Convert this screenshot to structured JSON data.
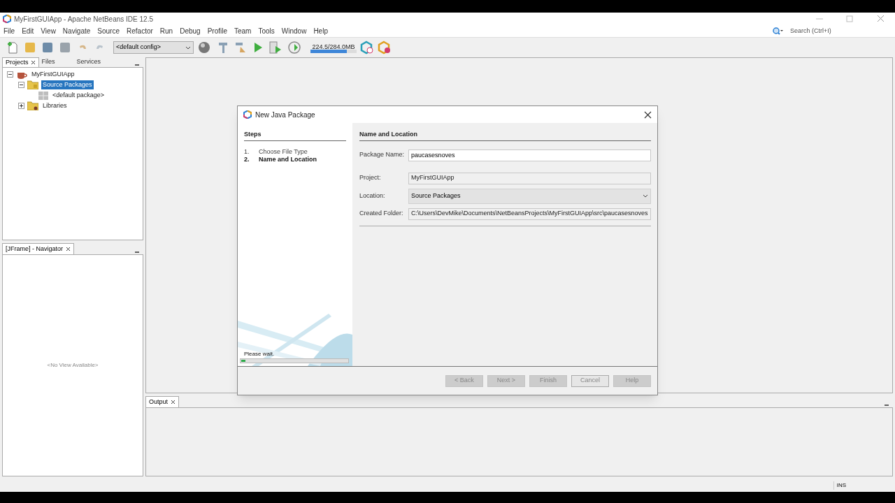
{
  "window": {
    "title": "MyFirstGUIApp - Apache NetBeans IDE 12.5"
  },
  "menu": [
    "File",
    "Edit",
    "View",
    "Navigate",
    "Source",
    "Refactor",
    "Run",
    "Debug",
    "Profile",
    "Team",
    "Tools",
    "Window",
    "Help"
  ],
  "search": {
    "placeholder": "Search (Ctrl+I)"
  },
  "toolbar": {
    "config": "<default config>",
    "memory": {
      "reading": "224.5/284.0MB",
      "level": 0.79
    }
  },
  "projects_panel": {
    "tabs": [
      {
        "label": "Projects",
        "selected": true
      },
      {
        "label": "Files",
        "selected": false
      },
      {
        "label": "Services",
        "selected": false
      }
    ],
    "tree": [
      {
        "label": "MyFirstGUIApp",
        "kind": "project",
        "expanded": true,
        "selected": false,
        "children": [
          {
            "label": "Source Packages",
            "kind": "folder",
            "expanded": true,
            "selected": true,
            "children": [
              {
                "label": "<default package>",
                "kind": "package",
                "selected": false
              }
            ]
          },
          {
            "label": "Libraries",
            "kind": "library",
            "expanded": false,
            "selected": false
          }
        ]
      }
    ]
  },
  "navigator": {
    "tab": "[JFrame] - Navigator",
    "empty_text": "<No View Available>"
  },
  "output": {
    "tab": "Output"
  },
  "status_bar": {
    "mode": "INS"
  },
  "dialog": {
    "title": "New Java Package",
    "steps_heading": "Steps",
    "steps": [
      {
        "number": "1.",
        "label": "Choose File Type",
        "current": false
      },
      {
        "number": "2.",
        "label": "Name and Location",
        "current": true
      }
    ],
    "heading": "Name and Location",
    "fields": [
      {
        "kind": "text",
        "label": "Package Name:",
        "value": "paucasesnoves"
      },
      {
        "kind": "readonly",
        "label": "Project:",
        "value": "MyFirstGUIApp"
      },
      {
        "kind": "select",
        "label": "Location:",
        "value": "Source Packages"
      },
      {
        "kind": "readonly",
        "label": "Created Folder:",
        "value": "C:\\Users\\DevMike\\Documents\\NetBeansProjects\\MyFirstGUIApp\\src\\paucasesnoves"
      }
    ],
    "progress": {
      "text": "Please wait.",
      "level": 0.04
    },
    "buttons": [
      {
        "label": "< Back",
        "disabled": true
      },
      {
        "label": "Next >",
        "disabled": true
      },
      {
        "label": "Finish",
        "disabled": true
      },
      {
        "label": "Cancel",
        "disabled": false
      },
      {
        "label": "Help",
        "disabled": true
      }
    ]
  }
}
